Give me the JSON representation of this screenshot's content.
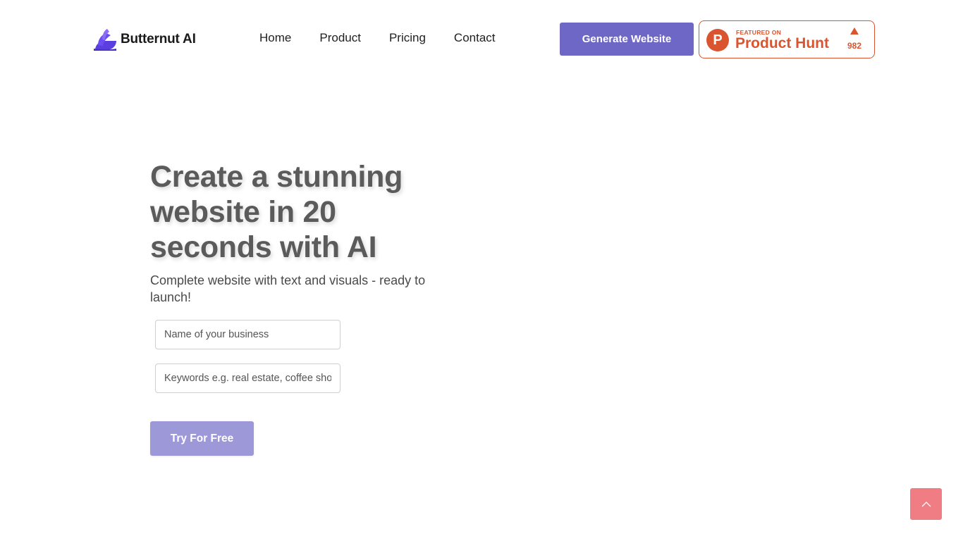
{
  "brand": {
    "name": "Butternut AI",
    "logo_icon": "butternut-logo-icon",
    "logo_color": "#5b3de0"
  },
  "nav": {
    "items": [
      {
        "label": "Home"
      },
      {
        "label": "Product"
      },
      {
        "label": "Pricing"
      },
      {
        "label": "Contact"
      }
    ]
  },
  "header": {
    "generate_label": "Generate Website",
    "generate_color": "#6f67c6"
  },
  "product_hunt": {
    "featured_text": "FEATURED ON",
    "name": "Product Hunt",
    "letter": "P",
    "count": "982",
    "color": "#da552f"
  },
  "hero": {
    "title": "Create a stunning website in 20 seconds with AI",
    "subtitle": "Complete website with text and visuals - ready to launch!",
    "business_placeholder": "Name of your business",
    "keywords_placeholder": "Keywords e.g. real estate, coffee shop",
    "try_label": "Try For Free",
    "try_color": "#9d98d8"
  },
  "scroll_top": {
    "icon": "chevron-up-icon",
    "color": "#f07c84"
  }
}
